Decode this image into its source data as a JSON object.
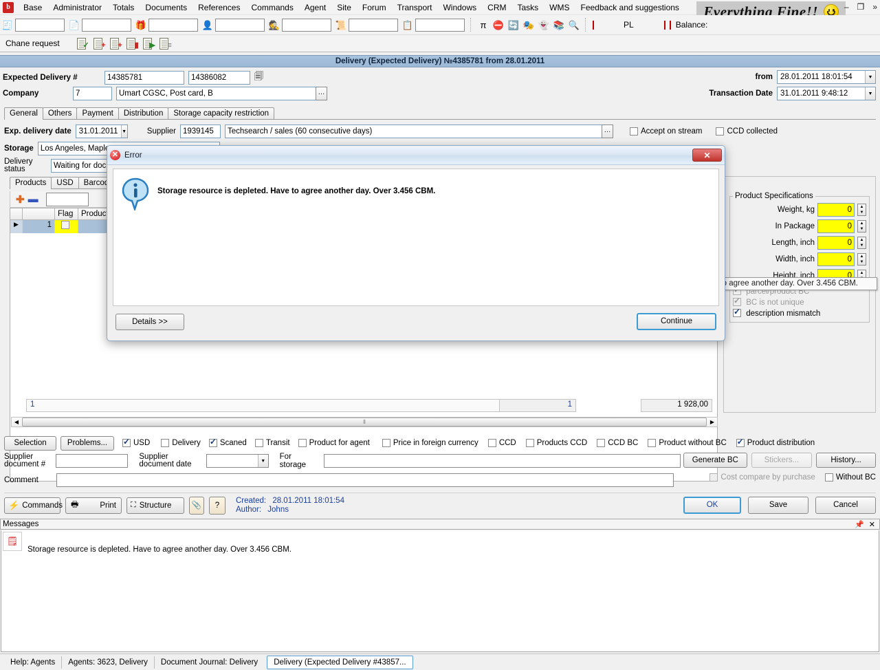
{
  "menu": {
    "logo": "app-logo",
    "items": [
      "Base",
      "Administrator",
      "Totals",
      "Documents",
      "References",
      "Commands",
      "Agent",
      "Site",
      "Forum",
      "Transport",
      "Windows",
      "CRM",
      "Tasks",
      "WMS",
      "Feedback and suggestions"
    ]
  },
  "banner": {
    "text": "Everything Fine!!",
    "icon": "smiley-icon"
  },
  "window_controls": {
    "minimize": "–",
    "restore": "❐",
    "more": "»"
  },
  "toolbar1": {
    "icons": [
      "document-number-icon",
      "document-icon",
      "gift-icon",
      "person-icon",
      "agent-icon",
      "scroll-icon",
      "clipboard-check-icon"
    ],
    "right_icons": [
      "pi-icon",
      "no-entry-icon",
      "refresh-icon",
      "mask-icon",
      "ghost-icon",
      "books-icon",
      "search-icon"
    ],
    "pl_label": "PL",
    "balance_label": "Balance:"
  },
  "toolbar2": {
    "label": "Chane request",
    "icons": [
      "doc-check-icon",
      "doc-add-check-icon",
      "doc-add-icon",
      "doc-delete-icon",
      "doc-run-icon",
      "doc-list-icon"
    ]
  },
  "document": {
    "title": "Delivery (Expected Delivery) №4385781 from 28.01.2011",
    "fields": {
      "expected_delivery_label": "Expected Delivery #",
      "expected_delivery_no": "14385781",
      "expected_delivery_no2": "14386082",
      "copy_icon": "copy-icon",
      "company_label": "Company",
      "company_code": "7",
      "company_name": "Umart CGSC, Post card, B",
      "from_label": "from",
      "from_value": "28.01.2011 18:01:54",
      "transaction_date_label": "Transaction Date",
      "transaction_date_value": "31.01.2011 9:48:12"
    },
    "tabs": [
      {
        "label": "General",
        "active": true
      },
      {
        "label": "Others",
        "active": false
      },
      {
        "label": "Payment",
        "active": false
      },
      {
        "label": "Distribution",
        "active": false
      },
      {
        "label": "Storage capacity restriction",
        "active": false
      }
    ],
    "general": {
      "exp_delivery_date_label": "Exp. delivery date",
      "exp_delivery_date_value": "31.01.2011",
      "supplier_label": "Supplier",
      "supplier_code": "1939145",
      "supplier_name": "Techsearch / sales (60 consecutive days)",
      "accept_on_stream_label": "Accept on stream",
      "accept_on_stream_checked": false,
      "ccd_collected_label": "CCD collected",
      "ccd_collected_checked": false,
      "storage_label": "Storage",
      "storage_value": "Los Angeles, Maple",
      "delivery_status_label": "Delivery status",
      "delivery_status_value": "Waiting for documents"
    },
    "product_tabs": [
      {
        "label": "Products",
        "active": true
      },
      {
        "label": "USD",
        "active": false
      },
      {
        "label": "Barcodes",
        "active": false
      }
    ],
    "grid_toolbar": {
      "add_icon": "plus-icon",
      "remove_icon": "minus-icon",
      "filter_value": ""
    },
    "grid": {
      "columns": [
        "",
        "",
        "Flag",
        "Product Code"
      ],
      "rows": [
        {
          "marker": "▶",
          "num": "1",
          "flag_checked": false,
          "product": ""
        }
      ],
      "footer": {
        "left_total": "1",
        "mid_total": "1",
        "right_total": "1 928,00"
      }
    },
    "specs": {
      "group_title": "Product Specifications",
      "rows": [
        {
          "label": "Weight, kg",
          "value": "0"
        },
        {
          "label": "In Package",
          "value": "0"
        },
        {
          "label": "Length, inch",
          "value": "0"
        },
        {
          "label": "Width, inch",
          "value": "0"
        },
        {
          "label": "Height, inch",
          "value": "0"
        }
      ],
      "checks": [
        {
          "label": "parcel/product BC",
          "checked": true,
          "disabled": true
        },
        {
          "label": "BC is not unique",
          "checked": true,
          "disabled": true
        },
        {
          "label": "description mismatch",
          "checked": true,
          "disabled": false
        }
      ]
    },
    "options_bar": {
      "selection_button": "Selection",
      "problems_button": "Problems...",
      "checks": [
        {
          "label": "USD",
          "checked": true
        },
        {
          "label": "Delivery",
          "checked": false
        },
        {
          "label": "Scaned",
          "checked": true
        },
        {
          "label": "Transit",
          "checked": false
        },
        {
          "label": "Product for agent",
          "checked": false
        },
        {
          "label": "Price in foreign currency",
          "checked": false
        },
        {
          "label": "CCD",
          "checked": false
        },
        {
          "label": "Products CCD",
          "checked": false
        },
        {
          "label": "CCD BC",
          "checked": false
        },
        {
          "label": "Product without BC",
          "checked": false
        },
        {
          "label": "Product distribution",
          "checked": true
        }
      ]
    },
    "lower_form": {
      "supplier_doc_label": "Supplier document #",
      "supplier_doc_value": "",
      "supplier_doc_date_label": "Supplier document date",
      "supplier_doc_date_value": "",
      "for_storage_label": "For storage",
      "for_storage_value": "",
      "comment_label": "Comment",
      "comment_value": "",
      "generate_bc_button": "Generate BC",
      "stickers_button": "Stickers...",
      "history_button": "History...",
      "cost_compare_label": "Cost compare by purchase",
      "cost_compare_checked": false,
      "without_bc_label": "Without BC",
      "without_bc_checked": false
    },
    "action_bar": {
      "commands_button": "Commands",
      "commands_icon": "lightning-icon",
      "print_button": "Print",
      "print_icon": "printer-icon",
      "structure_button": "Structure",
      "structure_icon": "structure-icon",
      "attachment_icon": "paperclip-icon",
      "help_icon": "question-icon",
      "created_label": "Created:",
      "created_value": "28.01.2011 18:01:54",
      "author_label": "Author:",
      "author_value": "Johns",
      "ok_button": "OK",
      "save_button": "Save",
      "cancel_button": "Cancel"
    }
  },
  "error_dialog": {
    "title": "Error",
    "title_icon": "error-icon",
    "close_label": "✕",
    "message_icon": "info-icon",
    "message": "Storage resource is depleted. Have to agree another day. Over 3.456 CBM.",
    "details_button": "Details >>",
    "continue_button": "Continue"
  },
  "tooltip": {
    "text": "Storage resource is depleted. Have to agree another day. Over 3.456 CBM."
  },
  "messages_panel": {
    "title": "Messages",
    "pin_icon": "pin-icon",
    "close_icon": "close-icon",
    "row_icon": "error-doc-icon",
    "rows": [
      "Storage resource is depleted. Have to agree another day. Over 3.456 CBM."
    ]
  },
  "statusbar": {
    "items": [
      {
        "label": "Help: Agents",
        "active": false
      },
      {
        "label": "Agents: 3623, Delivery",
        "active": false
      },
      {
        "label": "Document Journal: Delivery",
        "active": false
      },
      {
        "label": "Delivery (Expected Delivery #43857...",
        "active": true
      }
    ]
  },
  "colors": {
    "accent": "#3c9ad4",
    "title_bar": "#a8c3dd",
    "yellow_field": "#ffff00",
    "link_blue": "#1a3fa0",
    "error_red": "#cc1111"
  }
}
